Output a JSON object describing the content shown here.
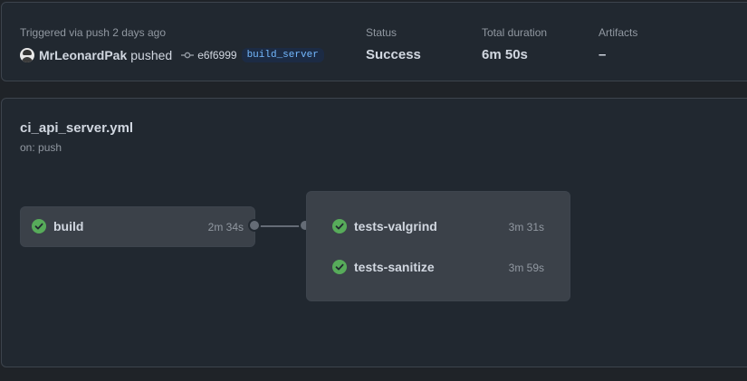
{
  "summary": {
    "trigger_text": "Triggered via push 2 days ago",
    "username": "MrLeonardPak",
    "action": "pushed",
    "commit_sha": "e6f6999",
    "branch": "build_server",
    "status_label": "Status",
    "status_value": "Success",
    "duration_label": "Total duration",
    "duration_value": "6m 50s",
    "artifacts_label": "Artifacts",
    "artifacts_value": "–"
  },
  "workflow": {
    "file_name": "ci_api_server.yml",
    "trigger": "on: push",
    "jobs": [
      {
        "name": "build",
        "duration": "2m 34s",
        "status": "success"
      }
    ],
    "test_jobs": [
      {
        "name": "tests-valgrind",
        "duration": "3m 31s",
        "status": "success"
      },
      {
        "name": "tests-sanitize",
        "duration": "3m 59s",
        "status": "success"
      }
    ]
  },
  "colors": {
    "success": "#57ab5a",
    "background": "#212830",
    "border": "#3d444d"
  },
  "icons": {
    "avatar": "user-avatar",
    "commit": "git-commit-icon",
    "job_status": "check-circle-icon"
  }
}
